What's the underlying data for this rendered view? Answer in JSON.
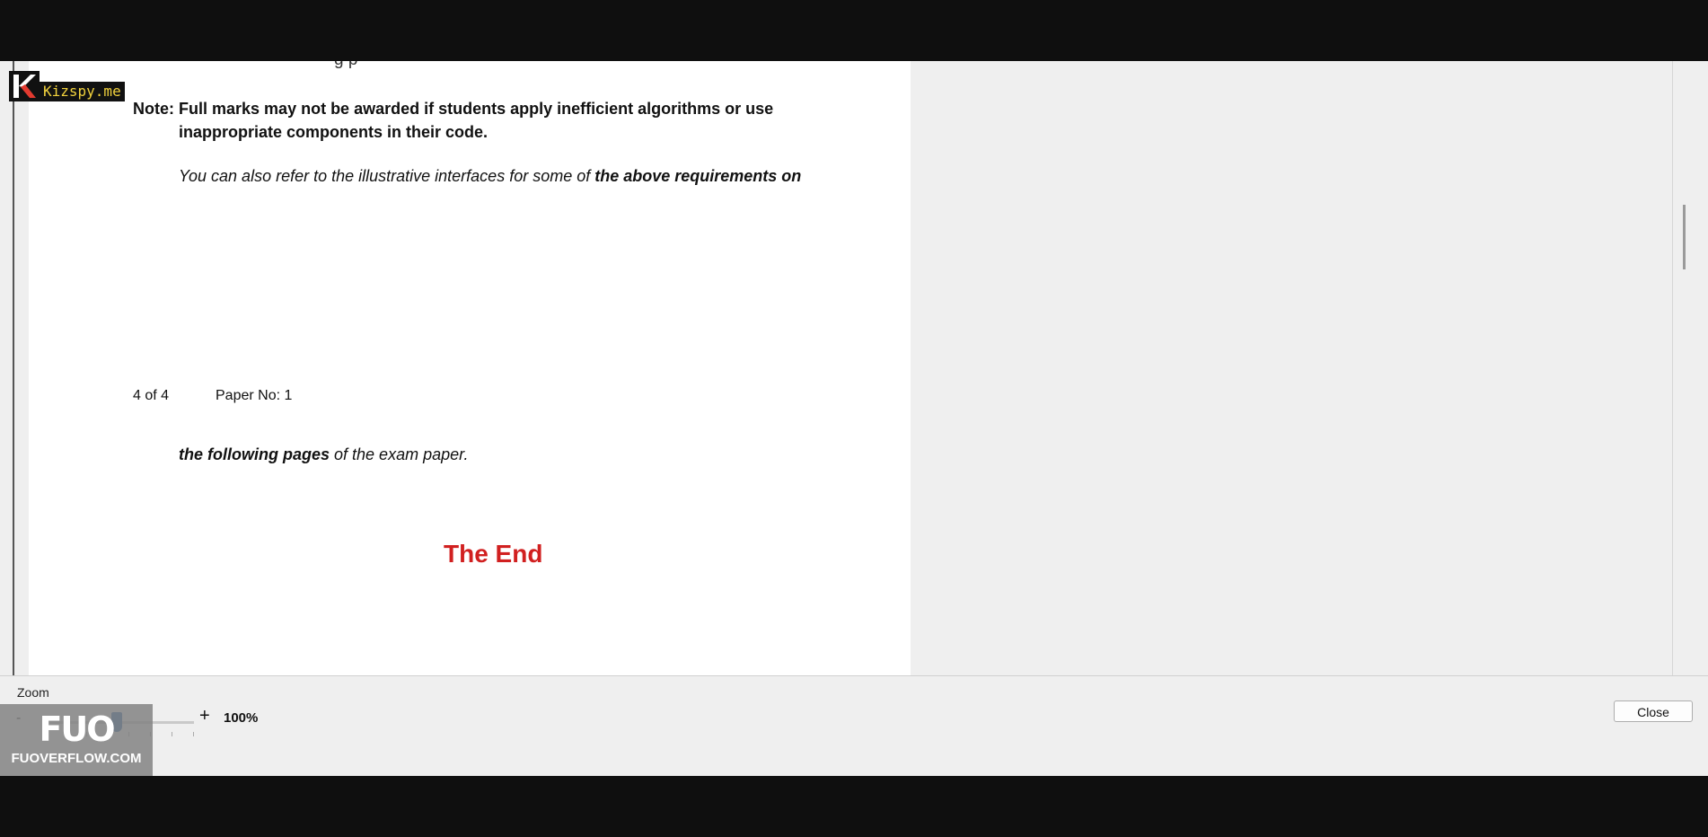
{
  "document": {
    "cut_line": "g   p",
    "note_label": "Note:",
    "note_line1": "Full marks may not be awarded if students apply inefficient algorithms or use",
    "note_line2": "inappropriate components in their code.",
    "refer_text": "You can also refer to the illustrative interfaces for some of ",
    "refer_bold": "the above requirements on",
    "footer_page": "4 of 4",
    "footer_paper": "Paper No: 1",
    "following_bold": "the following pages",
    "following_text": " of the exam paper.",
    "the_end": "The End"
  },
  "watermark_top": {
    "text": "Kizspy.me",
    "logo_letter": "K"
  },
  "zoom": {
    "label": "Zoom",
    "minus": "-",
    "plus": "+",
    "percent": "100%",
    "level": 100
  },
  "buttons": {
    "close": "Close"
  },
  "watermark_bottom": {
    "mark": "FUO",
    "site": "FUOVERFLOW.COM"
  },
  "colors": {
    "end_text": "#d12020",
    "slider_thumb": "#1f5fa8",
    "watermark_text": "#f2d23d"
  }
}
